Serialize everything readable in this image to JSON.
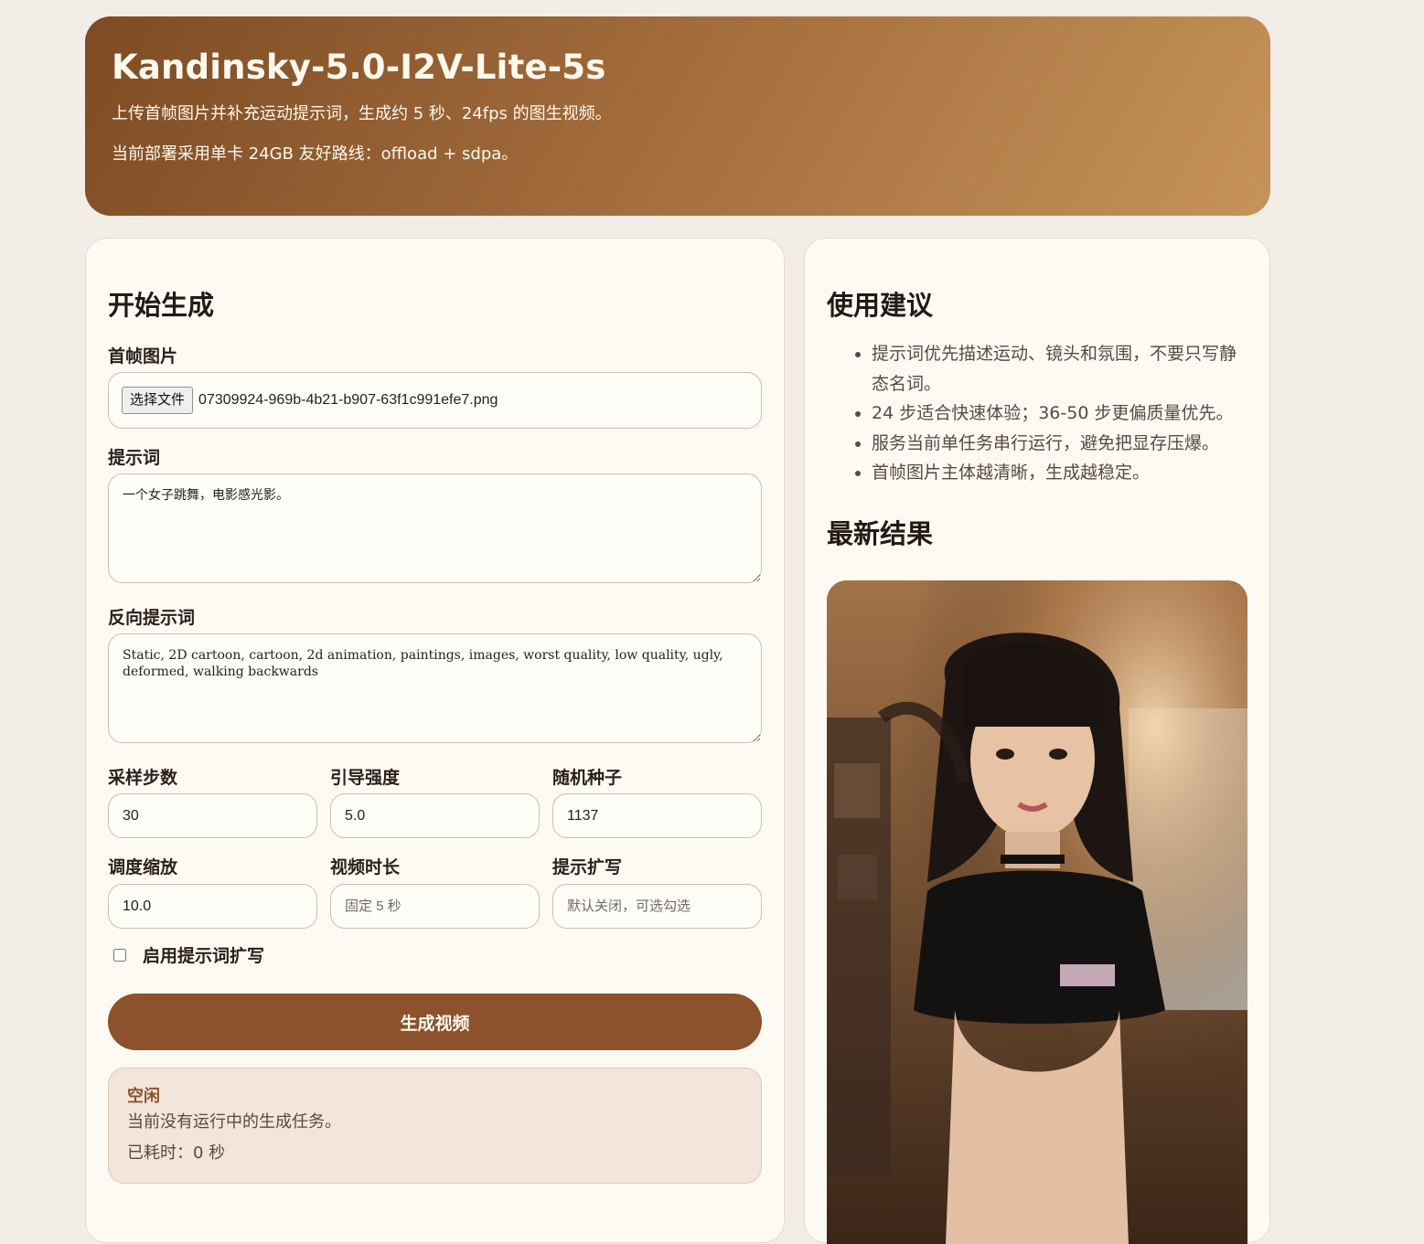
{
  "header": {
    "title": "Kandinsky-5.0-I2V-Lite-5s",
    "subtitle": "上传首帧图片并补充运动提示词，生成约 5 秒、24fps 的图生视频。",
    "deploy_note": "当前部署采用单卡 24GB 友好路线：offload + sdpa。"
  },
  "form": {
    "heading": "开始生成",
    "first_frame": {
      "label": "首帧图片",
      "button_label": "选择文件",
      "file_name": "07309924-969b-4b21-b907-63f1c991efe7.png"
    },
    "prompt": {
      "label": "提示词",
      "value": "一个女子跳舞，电影感光影。"
    },
    "negative_prompt": {
      "label": "反向提示词",
      "value": "Static, 2D cartoon, cartoon, 2d animation, paintings, images, worst quality, low quality, ugly, deformed, walking backwards"
    },
    "steps": {
      "label": "采样步数",
      "value": "30"
    },
    "guidance": {
      "label": "引导强度",
      "value": "5.0"
    },
    "seed": {
      "label": "随机种子",
      "value": "1137"
    },
    "scheduler_scale": {
      "label": "调度缩放",
      "value": "10.0"
    },
    "duration": {
      "label": "视频时长",
      "placeholder": "固定 5 秒"
    },
    "prompt_expand": {
      "label": "提示扩写",
      "placeholder": "默认关闭，可选勾选"
    },
    "expand_checkbox": {
      "label": "启用提示词扩写",
      "checked": false
    },
    "submit_label": "生成视频"
  },
  "status": {
    "title": "空闲",
    "message": "当前没有运行中的生成任务。",
    "elapsed": "已耗时：0 秒"
  },
  "tips": {
    "heading": "使用建议",
    "items": [
      "提示词优先描述运动、镜头和氛围，不要只写静态名词。",
      "24 步适合快速体验；36-50 步更偏质量优先。",
      "服务当前单任务串行运行，避免把显存压爆。",
      "首帧图片主体越清晰，生成越稳定。"
    ]
  },
  "result": {
    "heading": "最新结果"
  },
  "colors": {
    "accent": "#8b522b",
    "background": "#f2ede6",
    "card": "#fdfaf4"
  }
}
